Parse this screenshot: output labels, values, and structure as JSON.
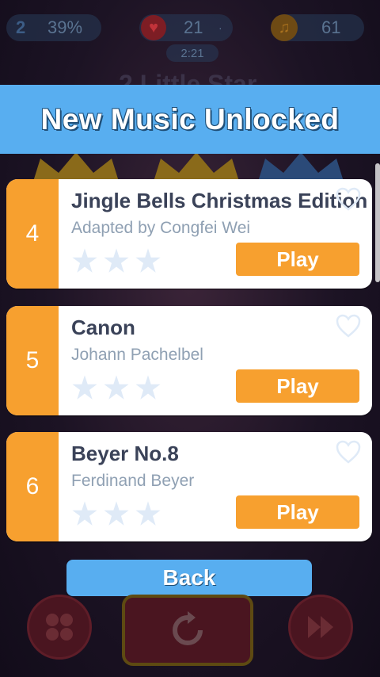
{
  "hud": {
    "level": "2",
    "progress": "39%",
    "lives": "21",
    "lives_dot": "·",
    "timer": "2:21",
    "notes": "61",
    "song_behind": "2 Little Star"
  },
  "modal": {
    "title": "New Music Unlocked"
  },
  "songs": [
    {
      "number": "4",
      "title": "Jingle Bells Christmas Edition",
      "artist": "Adapted by Congfei Wei",
      "stars_earned": 0,
      "stars_total": 3,
      "play_label": "Play"
    },
    {
      "number": "5",
      "title": "Canon",
      "artist": "Johann Pachelbel",
      "stars_earned": 0,
      "stars_total": 3,
      "play_label": "Play"
    },
    {
      "number": "6",
      "title": "Beyer No.8",
      "artist": "Ferdinand Beyer",
      "stars_earned": 0,
      "stars_total": 3,
      "play_label": "Play"
    }
  ],
  "back_label": "Back",
  "colors": {
    "header_blue": "#58aef0",
    "accent_orange": "#f7a02f",
    "title_text": "#3a4258",
    "artist_text": "#8fa0b3",
    "star_empty": "#dfeaf7"
  },
  "icons": {
    "lives": "heart-icon",
    "notes": "music-note-icon",
    "favorite": "heart-outline-icon",
    "star": "star-icon",
    "menu": "menu-grid-icon",
    "replay": "replay-icon",
    "next": "fast-forward-icon"
  }
}
